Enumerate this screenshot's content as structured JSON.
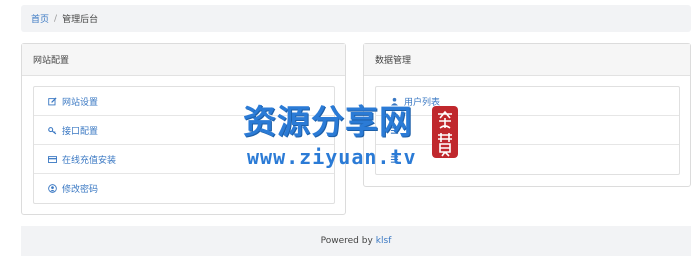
{
  "breadcrumb": {
    "home": "首页",
    "separator": "/",
    "current": "管理后台"
  },
  "left_panel": {
    "title": "网站配置",
    "items": [
      {
        "label": "网站设置",
        "icon": "edit-icon"
      },
      {
        "label": "接口配置",
        "icon": "key-icon"
      },
      {
        "label": "在线充值安装",
        "icon": "card-icon"
      },
      {
        "label": "修改密码",
        "icon": "user-circle-icon"
      }
    ]
  },
  "right_panel": {
    "title": "数据管理",
    "items": [
      {
        "label": "用户列表",
        "icon": "user-icon"
      },
      {
        "label": "",
        "icon": "list-icon"
      },
      {
        "label": "",
        "icon": "list-icon"
      }
    ]
  },
  "footer": {
    "text": "Powered by",
    "link": "klsf"
  },
  "watermark": {
    "title": "资源分享网",
    "url": "www.ziyuan.tv",
    "seal": "免费"
  },
  "colors": {
    "link": "#3a78c3",
    "watermark": "#2b7bd6",
    "seal": "#c0282d"
  }
}
